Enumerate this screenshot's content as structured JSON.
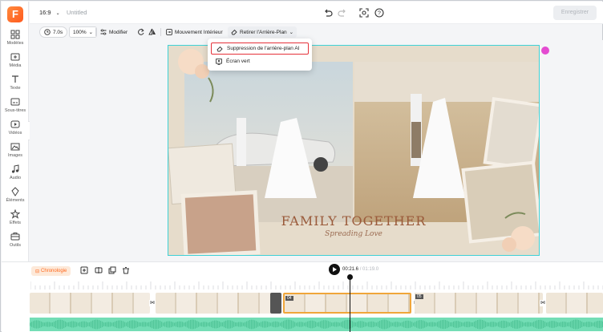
{
  "app": {
    "logo_letter": "F",
    "project_title": "Untitled",
    "aspect_ratio": "16:9",
    "export_label": "Enregistrer"
  },
  "sidebar": {
    "items": [
      {
        "label": "Modèles",
        "icon": "templates-icon"
      },
      {
        "label": "Média",
        "icon": "media-icon"
      },
      {
        "label": "Texte",
        "icon": "text-icon"
      },
      {
        "label": "Sous-titres",
        "icon": "subtitles-icon"
      },
      {
        "label": "Vidéos",
        "icon": "videos-icon"
      },
      {
        "label": "Images",
        "icon": "images-icon"
      },
      {
        "label": "Audio",
        "icon": "audio-icon"
      },
      {
        "label": "Éléments",
        "icon": "elements-icon"
      },
      {
        "label": "Effets",
        "icon": "effects-icon"
      },
      {
        "label": "Outils",
        "icon": "tools-icon"
      }
    ]
  },
  "toolbar": {
    "duration": "7.0s",
    "zoom": "100%",
    "modify_label": "Modifier",
    "motion_label": "Mouvement Intérieur",
    "remove_bg_label": "Retirer l'Arrière-Plan"
  },
  "dropdown": {
    "items": [
      {
        "label": "Suppression de l'arrière-plan AI",
        "icon": "eraser-icon",
        "highlighted": true
      },
      {
        "label": "Écran vert",
        "icon": "green-screen-icon",
        "highlighted": false
      }
    ]
  },
  "canvas": {
    "title": "FAMILY TOGETHER",
    "subtitle": "Spreading Love",
    "border_color": "#3fd1d6"
  },
  "timeline": {
    "chrono_label": "Chronologie",
    "current_time": "00:21.6",
    "total_time": "/ 01:19.0",
    "clip_numbers": [
      "04",
      "05"
    ],
    "accent": "#f0a63a",
    "audio_color": "#73ddb5"
  }
}
